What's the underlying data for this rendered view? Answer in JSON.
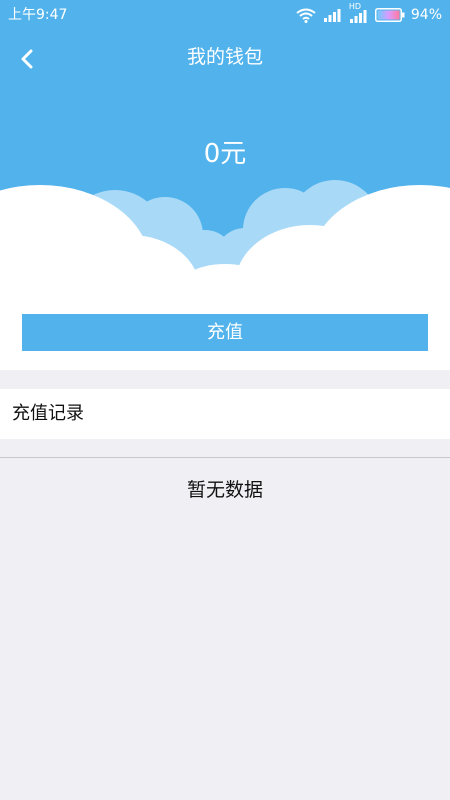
{
  "status_bar": {
    "time": "上午9:47",
    "battery_percent": "94%",
    "network_label": "HD",
    "icons": [
      "wifi-icon",
      "signal-icon",
      "signal-hd-icon",
      "battery-icon"
    ]
  },
  "header": {
    "title": "我的钱包",
    "balance": "0元",
    "back_icon": "chevron-left-icon"
  },
  "actions": {
    "recharge_label": "充值"
  },
  "records": {
    "title": "充值记录",
    "empty_text": "暂无数据"
  },
  "colors": {
    "primary": "#52b3ec",
    "cloud_light": "#a8d9f7",
    "background": "#efeff4",
    "surface": "#ffffff"
  }
}
